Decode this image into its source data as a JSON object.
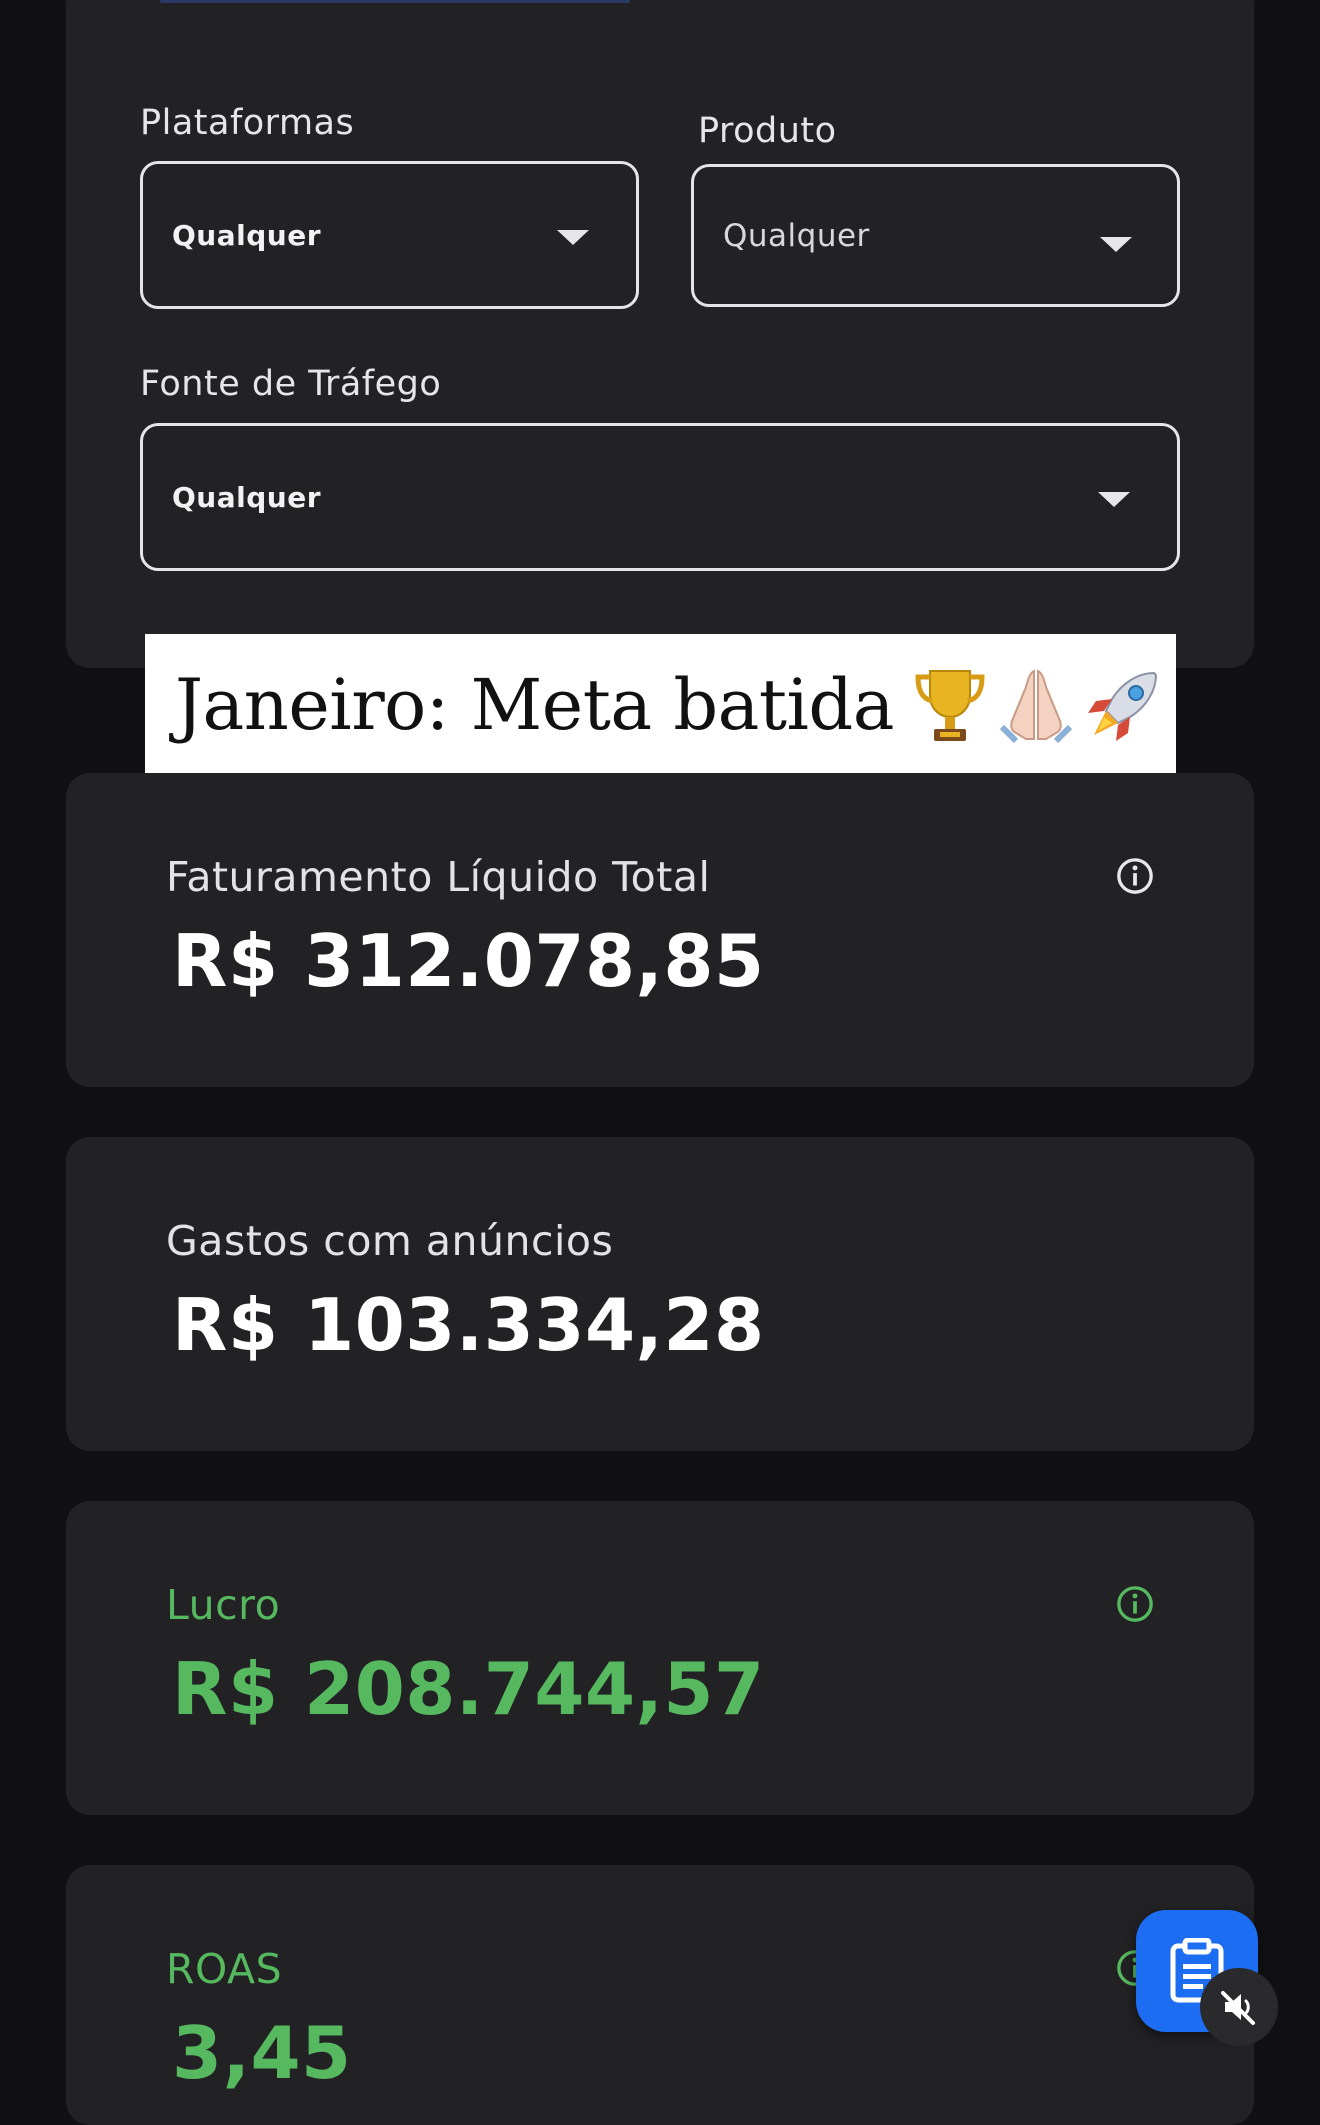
{
  "filters": {
    "platforms": {
      "label": "Plataformas",
      "value": "Qualquer"
    },
    "product": {
      "label": "Produto",
      "value": "Qualquer"
    },
    "traffic_source": {
      "label": "Fonte de Tráfego",
      "value": "Qualquer"
    }
  },
  "overlay": {
    "text": "Janeiro: Meta batida",
    "emojis": [
      "trophy",
      "praying-hands",
      "rocket"
    ]
  },
  "metrics": {
    "revenue": {
      "label": "Faturamento Líquido Total",
      "value": "R$ 312.078,85"
    },
    "ad_spend": {
      "label": "Gastos com anúncios",
      "value": "R$ 103.334,28"
    },
    "profit": {
      "label": "Lucro",
      "value": "R$ 208.744,57",
      "color": "#56b85f"
    },
    "roas": {
      "label": "ROAS",
      "value": "3,45",
      "color": "#56b85f"
    }
  },
  "colors": {
    "background": "#111013",
    "card": "#222124",
    "accent_blue": "#1c6df2",
    "positive_green": "#56b85f"
  }
}
